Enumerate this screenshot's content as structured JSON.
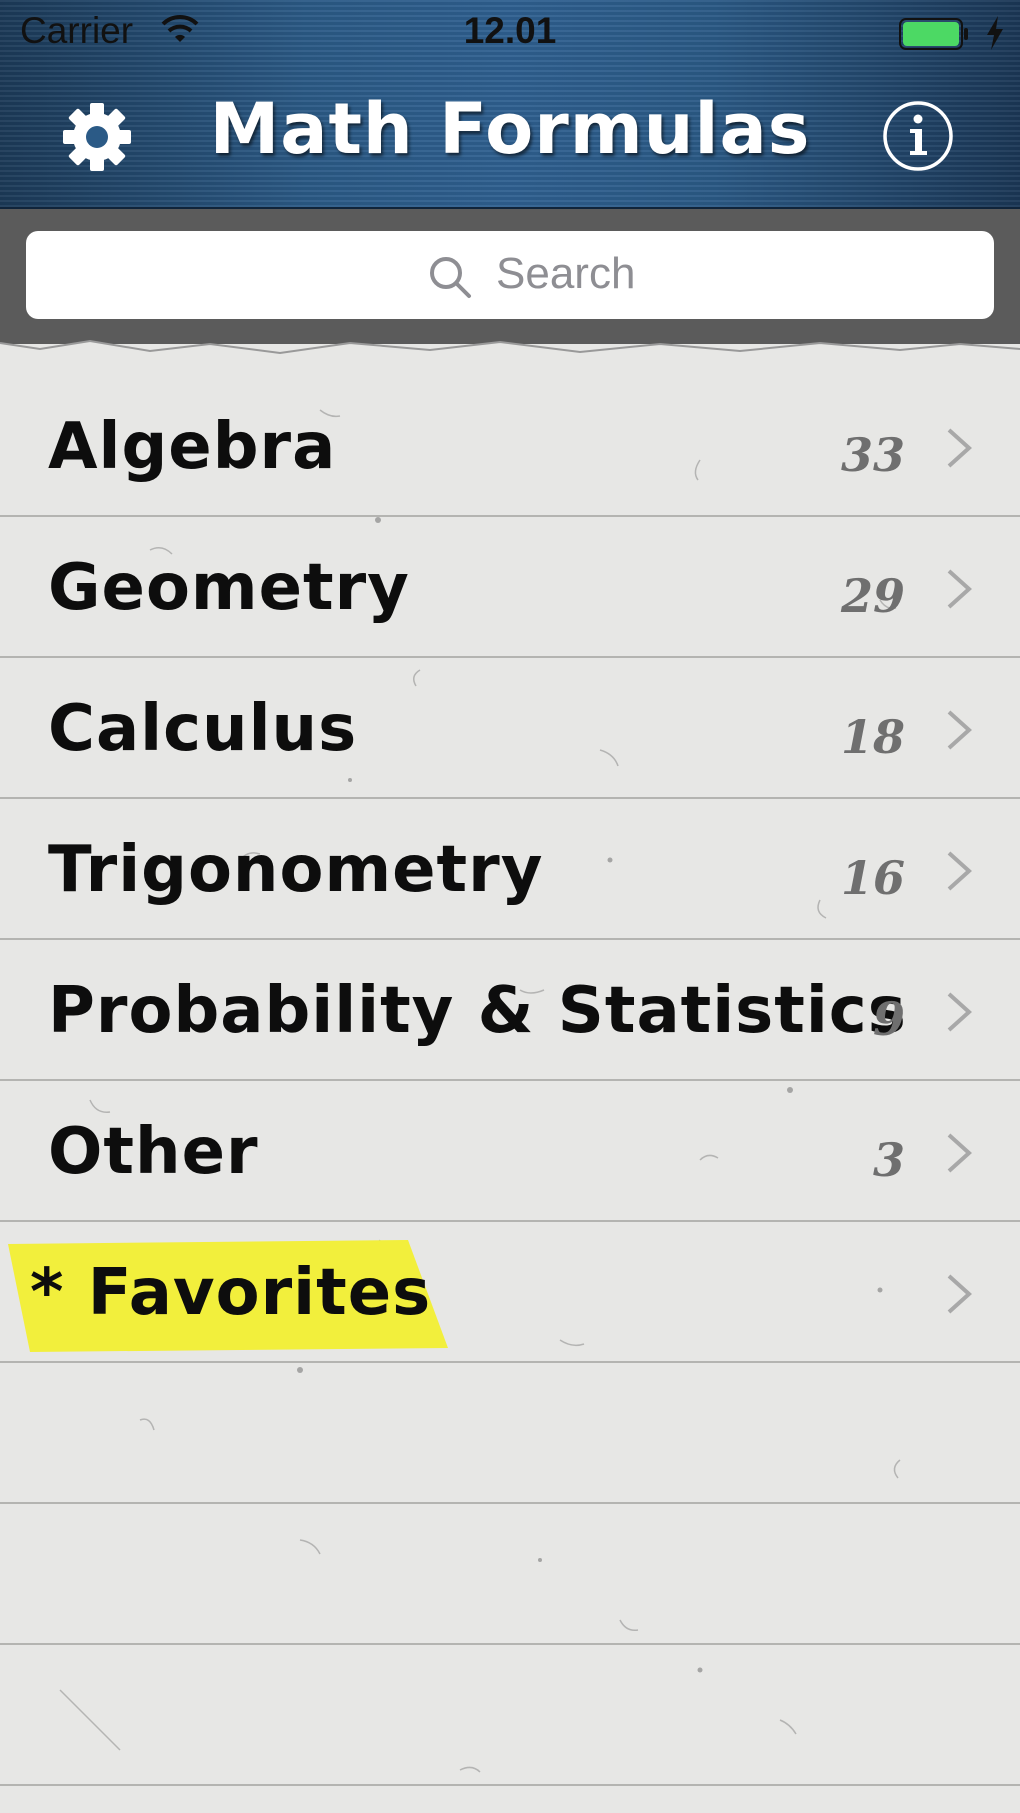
{
  "status_bar": {
    "carrier": "Carrier",
    "time": "12.01",
    "battery_color": "#4cd964"
  },
  "nav": {
    "title": "Math Formulas",
    "left_icon": "gear-icon",
    "right_icon": "info-icon"
  },
  "search": {
    "placeholder": "Search"
  },
  "categories": [
    {
      "label": "Algebra",
      "count": "33"
    },
    {
      "label": "Geometry",
      "count": "29"
    },
    {
      "label": "Calculus",
      "count": "18"
    },
    {
      "label": "Trigonometry",
      "count": "16"
    },
    {
      "label": "Probability & Statistics",
      "count": "9"
    },
    {
      "label": "Other",
      "count": "3"
    },
    {
      "label": "* Favorites",
      "count": ""
    }
  ],
  "colors": {
    "header_blue": "#2b5a86",
    "highlight_yellow": "#f2ef3c",
    "paper": "#e7e7e5",
    "count_gray": "#6f6f6f"
  }
}
